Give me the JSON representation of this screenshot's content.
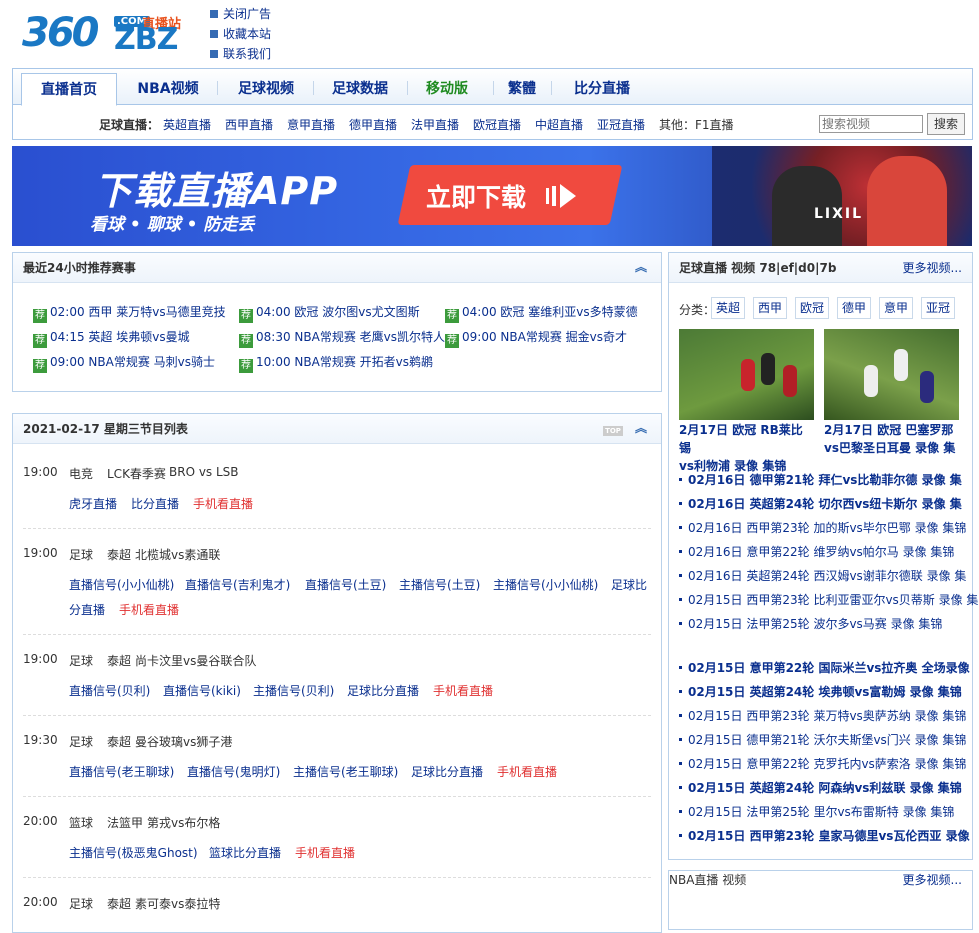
{
  "header": {
    "logo": {
      "num": "360",
      "zbz": "ZBZ",
      "com": ".COM",
      "sub": "直播站"
    },
    "links": [
      "关闭广告",
      "收藏本站",
      "联系我们"
    ]
  },
  "nav": {
    "items": [
      "直播首页",
      "NBA视频",
      "足球视频",
      "足球数据",
      "移动版",
      "繁體",
      "比分直播"
    ],
    "sub_label": "足球直播：",
    "sub_links": [
      "英超直播",
      "西甲直播",
      "意甲直播",
      "德甲直播",
      "法甲直播",
      "欧冠直播",
      "中超直播",
      "亚冠直播",
      "其他：F1直播"
    ],
    "search_placeholder": "搜索视频",
    "search_button": "搜索"
  },
  "banner": {
    "title": "下载直播APP",
    "subtitle": "看球 • 聊球 • 防走丢",
    "button": "立即下载",
    "brand": "LIXIL"
  },
  "recommend": {
    "title": "最近24小时推荐赛事",
    "tag": "荐",
    "items": [
      "02:00 西甲 莱万特vs马德里竞技",
      "04:00 欧冠 波尔图vs尤文图斯",
      "04:00 欧冠 塞维利亚vs多特蒙德",
      "04:15 英超 埃弗顿vs曼城",
      "08:30 NBA常规赛 老鹰vs凯尔特人",
      "09:00 NBA常规赛 掘金vs奇才",
      "09:00 NBA常规赛 马刺vs骑士",
      "10:00 NBA常规赛 开拓者vs鹈鹕"
    ]
  },
  "schedule": {
    "title": "2021-02-17 星期三节目列表",
    "top": "TOP",
    "rows": [
      {
        "time": "19:00",
        "type": "电竞",
        "league": "LCK春季赛",
        "match": "BRO vs LSB",
        "links": [
          "虎牙直播",
          "比分直播"
        ],
        "mobile": "手机看直播"
      },
      {
        "time": "19:00",
        "type": "足球",
        "league": "泰超",
        "match": "北榄城vs素通联",
        "links": [
          "直播信号(小小仙桃)",
          "直播信号(吉利鬼才)",
          "直播信号(土豆)",
          "主播信号(土豆)",
          "主播信号(小小仙桃)",
          "足球比",
          "分直播"
        ],
        "mobile": "手机看直播"
      },
      {
        "time": "19:00",
        "type": "足球",
        "league": "泰超",
        "match": "尚卡汶里vs曼谷联合队",
        "links": [
          "直播信号(贝利)",
          "直播信号(kiki)",
          "主播信号(贝利)",
          "足球比分直播"
        ],
        "mobile": "手机看直播"
      },
      {
        "time": "19:30",
        "type": "足球",
        "league": "泰超",
        "match": "曼谷玻璃vs狮子港",
        "links": [
          "直播信号(老王聊球)",
          "直播信号(鬼明灯)",
          "主播信号(老王聊球)",
          "足球比分直播"
        ],
        "mobile": "手机看直播"
      },
      {
        "time": "20:00",
        "type": "篮球",
        "league": "法篮甲",
        "match": "第戎vs布尔格",
        "links": [
          "主播信号(极恶鬼Ghost)",
          "篮球比分直播"
        ],
        "mobile": "手机看直播"
      },
      {
        "time": "20:00",
        "type": "足球",
        "league": "泰超",
        "match": "素可泰vs泰拉特"
      }
    ]
  },
  "right": {
    "title": "足球直播 视频 78|ef|d0|7b",
    "more": "更多视频...",
    "cat_label": "分类：",
    "cats": [
      "英超",
      "西甲",
      "欧冠",
      "德甲",
      "意甲",
      "亚冠"
    ],
    "thumbs": [
      {
        "line1": "2月17日 欧冠 RB莱比锡",
        "line2": "vs利物浦 录像 集锦"
      },
      {
        "line1": "2月17日 欧冠 巴塞罗那",
        "line2": "vs巴黎圣日耳曼 录像 集"
      }
    ],
    "news": [
      {
        "text": "02月16日 德甲第21轮 拜仁vs比勒菲尔德 录像 集",
        "bold": true
      },
      {
        "text": "02月16日 英超第24轮 切尔西vs纽卡斯尔 录像 集",
        "bold": true
      },
      {
        "text": "02月16日 西甲第23轮 加的斯vs毕尔巴鄂 录像 集锦",
        "bold": false
      },
      {
        "text": "02月16日 意甲第22轮 维罗纳vs帕尔马 录像 集锦",
        "bold": false
      },
      {
        "text": "02月16日 英超第24轮 西汉姆vs谢菲尔德联 录像 集",
        "bold": false
      },
      {
        "text": "02月15日 西甲第23轮 比利亚雷亚尔vs贝蒂斯 录像 集",
        "bold": false
      },
      {
        "text": "02月15日 法甲第25轮 波尔多vs马赛 录像 集锦",
        "bold": false
      },
      {
        "text": "02月15日 意甲第22轮 国际米兰vs拉齐奥 全场录像",
        "bold": true
      },
      {
        "text": "02月15日 英超第24轮 埃弗顿vs富勒姆 录像 集锦",
        "bold": true
      },
      {
        "text": "02月15日 西甲第23轮 莱万特vs奥萨苏纳 录像 集锦",
        "bold": false
      },
      {
        "text": "02月15日 德甲第21轮 沃尔夫斯堡vs门兴 录像 集锦",
        "bold": false
      },
      {
        "text": "02月15日 意甲第22轮 克罗托内vs萨索洛 录像 集锦",
        "bold": false
      },
      {
        "text": "02月15日 英超第24轮 阿森纳vs利兹联 录像 集锦",
        "bold": true
      },
      {
        "text": "02月15日 法甲第25轮 里尔vs布雷斯特 录像 集锦",
        "bold": false
      },
      {
        "text": "02月15日 西甲第23轮 皇家马德里vs瓦伦西亚 录像",
        "bold": true
      }
    ],
    "nba_title": "NBA直播 视频",
    "nba_more": "更多视频..."
  }
}
